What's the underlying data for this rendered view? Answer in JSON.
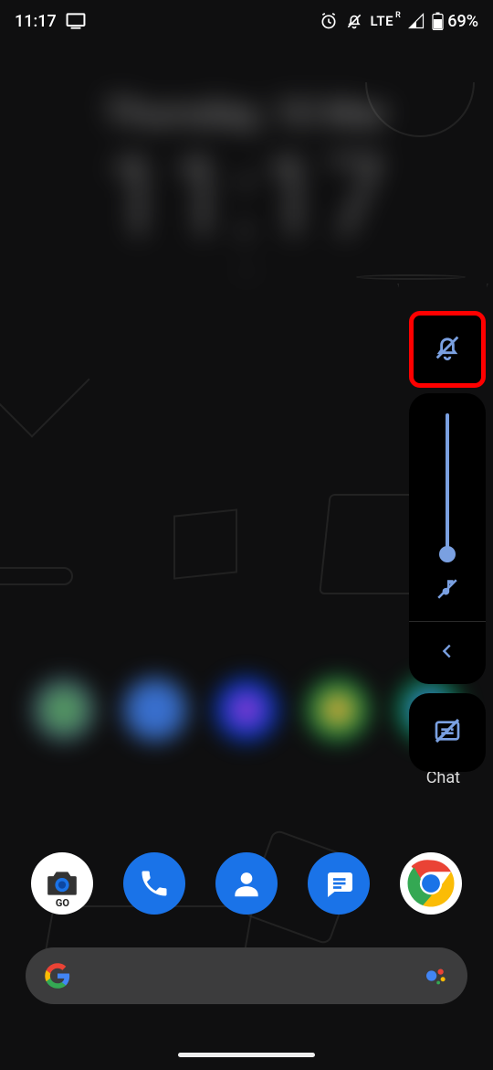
{
  "status": {
    "time": "11:17",
    "icons": {
      "cast": "cast-icon",
      "alarm": "alarm-icon",
      "notif_silent": "notifications-off-icon",
      "network_label": "LTE",
      "network_sup": "R",
      "signal": "signal-icon",
      "battery": "battery-icon",
      "battery_pct": "69%"
    }
  },
  "clock_widget": {
    "day": "Thursday, 10 Mar",
    "time": "11:17",
    "sub": "—"
  },
  "app_row": {
    "items": [
      {
        "label": ""
      },
      {
        "label": ""
      },
      {
        "label": ""
      },
      {
        "label": ""
      },
      {
        "label": "Chat"
      }
    ]
  },
  "volume_panel": {
    "ring_mode": "silent",
    "ring_icon": "notifications-off-icon",
    "slider_value_pct": 0,
    "media_icon": "music-off-icon",
    "expand_icon": "chevron-left-icon",
    "caption_icon": "live-caption-off-icon"
  },
  "dock": {
    "items": [
      {
        "name": "camera-go",
        "sub": "GO"
      },
      {
        "name": "phone"
      },
      {
        "name": "contacts"
      },
      {
        "name": "messages"
      },
      {
        "name": "chrome"
      }
    ]
  },
  "search": {
    "google_icon": "google-g-icon",
    "assistant_icon": "assistant-icon"
  },
  "highlight": {
    "target": "ring-mode-button",
    "color": "#ff0000"
  }
}
